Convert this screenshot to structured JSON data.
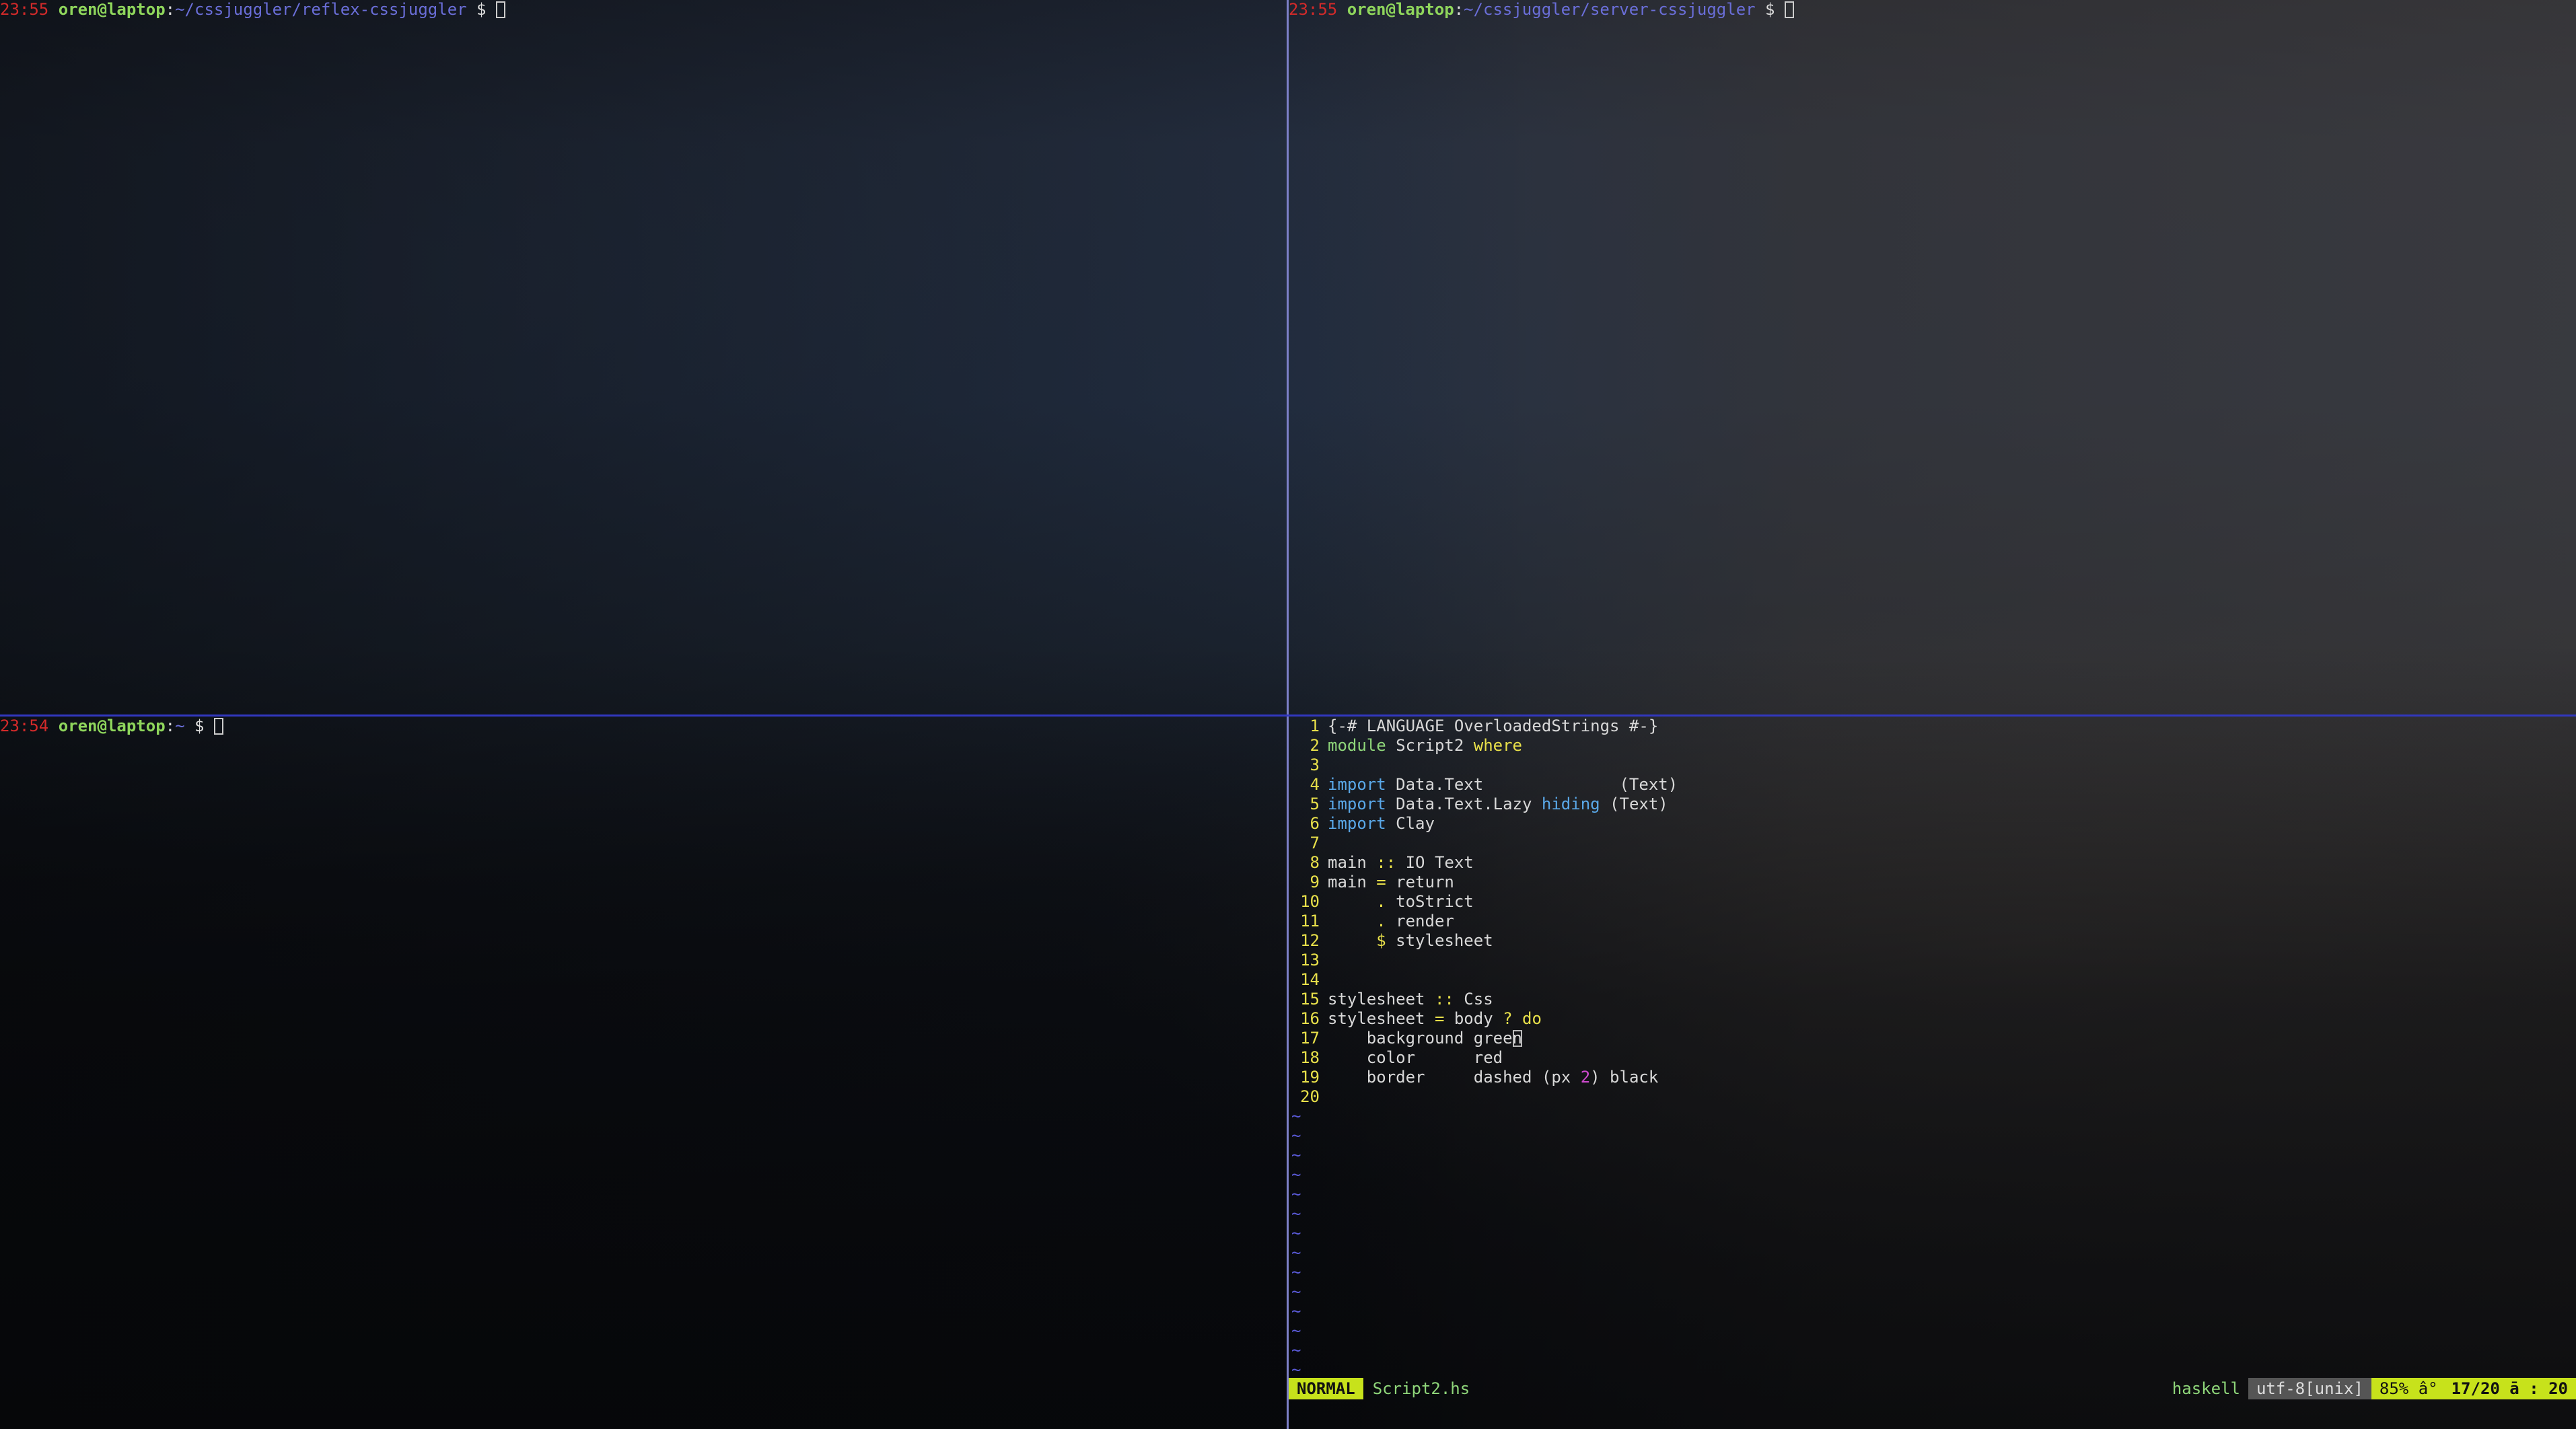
{
  "panes": {
    "top_left": {
      "time": "23:55",
      "user": "oren@laptop",
      "sep": ":",
      "path": "~/cssjuggler/reflex-cssjuggler",
      "dollar": " $ "
    },
    "top_right": {
      "time": "23:55",
      "user": "oren@laptop",
      "sep": ":",
      "path": "~/cssjuggler/server-cssjuggler",
      "dollar": " $ "
    },
    "bottom_left": {
      "time": "23:54",
      "user": "oren@laptop",
      "sep": ":",
      "path": "~",
      "dollar": " $ "
    }
  },
  "editor": {
    "lines": [
      {
        "n": "1",
        "tokens": [
          {
            "t": "{-# LANGUAGE OverloadedStrings #-}",
            "c": "#d8d8d8"
          }
        ]
      },
      {
        "n": "2",
        "tokens": [
          {
            "t": "module",
            "c": "#8fd67a"
          },
          {
            "t": " Script2 ",
            "c": "#d8d8d8"
          },
          {
            "t": "where",
            "c": "#e8e04a"
          }
        ]
      },
      {
        "n": "3",
        "tokens": []
      },
      {
        "n": "4",
        "tokens": [
          {
            "t": "import",
            "c": "#5aa8e8"
          },
          {
            "t": " Data.Text              (Text)",
            "c": "#d8d8d8"
          }
        ]
      },
      {
        "n": "5",
        "tokens": [
          {
            "t": "import",
            "c": "#5aa8e8"
          },
          {
            "t": " Data.Text.Lazy ",
            "c": "#d8d8d8"
          },
          {
            "t": "hiding",
            "c": "#5aa8e8"
          },
          {
            "t": " (Text)",
            "c": "#d8d8d8"
          }
        ]
      },
      {
        "n": "6",
        "tokens": [
          {
            "t": "import",
            "c": "#5aa8e8"
          },
          {
            "t": " Clay",
            "c": "#d8d8d8"
          }
        ]
      },
      {
        "n": "7",
        "tokens": []
      },
      {
        "n": "8",
        "tokens": [
          {
            "t": "main ",
            "c": "#d8d8d8"
          },
          {
            "t": "::",
            "c": "#e8e04a"
          },
          {
            "t": " IO Text",
            "c": "#d8d8d8"
          }
        ]
      },
      {
        "n": "9",
        "tokens": [
          {
            "t": "main ",
            "c": "#d8d8d8"
          },
          {
            "t": "=",
            "c": "#e8e04a"
          },
          {
            "t": " return",
            "c": "#d8d8d8"
          }
        ]
      },
      {
        "n": "10",
        "tokens": [
          {
            "t": "     ",
            "c": "#d8d8d8"
          },
          {
            "t": ".",
            "c": "#e8e04a"
          },
          {
            "t": " toStrict",
            "c": "#d8d8d8"
          }
        ]
      },
      {
        "n": "11",
        "tokens": [
          {
            "t": "     ",
            "c": "#d8d8d8"
          },
          {
            "t": ".",
            "c": "#e8e04a"
          },
          {
            "t": " render",
            "c": "#d8d8d8"
          }
        ]
      },
      {
        "n": "12",
        "tokens": [
          {
            "t": "     ",
            "c": "#d8d8d8"
          },
          {
            "t": "$",
            "c": "#e8e04a"
          },
          {
            "t": " stylesheet",
            "c": "#d8d8d8"
          }
        ]
      },
      {
        "n": "13",
        "tokens": []
      },
      {
        "n": "14",
        "tokens": []
      },
      {
        "n": "15",
        "tokens": [
          {
            "t": "stylesheet ",
            "c": "#d8d8d8"
          },
          {
            "t": "::",
            "c": "#e8e04a"
          },
          {
            "t": " Css",
            "c": "#d8d8d8"
          }
        ]
      },
      {
        "n": "16",
        "tokens": [
          {
            "t": "stylesheet ",
            "c": "#d8d8d8"
          },
          {
            "t": "=",
            "c": "#e8e04a"
          },
          {
            "t": " body ",
            "c": "#d8d8d8"
          },
          {
            "t": "?",
            "c": "#e8e04a"
          },
          {
            "t": " ",
            "c": "#d8d8d8"
          },
          {
            "t": "do",
            "c": "#e8e04a"
          }
        ]
      },
      {
        "n": "17",
        "tokens": [
          {
            "t": "    background green",
            "c": "#d8d8d8"
          }
        ],
        "cursor": true
      },
      {
        "n": "18",
        "tokens": [
          {
            "t": "    color      red",
            "c": "#d8d8d8"
          }
        ]
      },
      {
        "n": "19",
        "tokens": [
          {
            "t": "    border     dashed (px ",
            "c": "#d8d8d8"
          },
          {
            "t": "2",
            "c": "#d04ad0"
          },
          {
            "t": ") black",
            "c": "#d8d8d8"
          }
        ]
      },
      {
        "n": "20",
        "tokens": []
      }
    ],
    "tildes": [
      "~",
      "~",
      "~",
      "~",
      "~",
      "~",
      "~",
      "~",
      "~",
      "~",
      "~",
      "~",
      "~",
      "~"
    ],
    "status": {
      "mode": "NORMAL",
      "filename": "Script2.hs",
      "filetype": "haskell",
      "encoding": "utf-8[unix]",
      "percent": "85% â°",
      "position": "17/20 ā : 20"
    }
  },
  "colors": {
    "divider_vertical": "#7d80c8",
    "divider_horizontal": "#3238c0",
    "keyword_green": "#8fd67a",
    "keyword_yellow": "#e8e04a",
    "keyword_blue": "#5aa8e8",
    "number_magenta": "#d04ad0",
    "status_accent": "#c7e21b"
  }
}
